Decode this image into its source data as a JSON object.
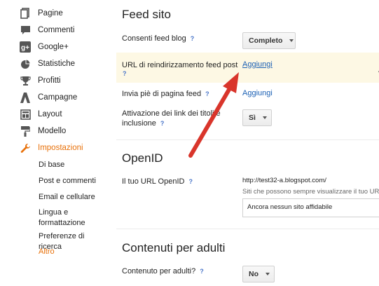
{
  "sidebar": {
    "items": [
      {
        "label": "Pagine",
        "icon": "pages-icon"
      },
      {
        "label": "Commenti",
        "icon": "comment-icon"
      },
      {
        "label": "Google+",
        "icon": "google-plus-icon"
      },
      {
        "label": "Statistiche",
        "icon": "pie-chart-icon"
      },
      {
        "label": "Profitti",
        "icon": "trophy-icon"
      },
      {
        "label": "Campagne",
        "icon": "campaign-icon"
      },
      {
        "label": "Layout",
        "icon": "layout-icon"
      },
      {
        "label": "Modello",
        "icon": "paint-roller-icon"
      },
      {
        "label": "Impostazioni",
        "icon": "wrench-icon"
      }
    ],
    "subitems": [
      "Di base",
      "Post e commenti",
      "Email e cellulare",
      "Lingua e formattazione",
      "Preferenze di ricerca",
      "Altro"
    ]
  },
  "feed": {
    "title": "Feed sito",
    "allow_label": "Consenti feed blog",
    "allow_value": "Completo",
    "redirect_label": "URL di reindirizzamento feed post",
    "redirect_action": "Aggiungi",
    "footer_label": "Invia piè di pagina feed",
    "footer_action": "Aggiungi",
    "title_links_label": "Attivazione dei link dei titoli e inclusione",
    "title_links_value": "Sì",
    "help_mark": "?"
  },
  "openid": {
    "title": "OpenID",
    "url_label": "Il tuo URL OpenID",
    "url_value": "http://test32-a.blogspot.com/",
    "trusted_hint": "Siti che possono sempre visualizzare il tuo URL",
    "trusted_box": "Ancora nessun sito affidabile"
  },
  "adult": {
    "title": "Contenuti per adulti",
    "label": "Contenuto per adulti?",
    "value": "No"
  },
  "colors": {
    "accent": "#e8710a",
    "link": "#1a5fb4",
    "arrow": "#d9352b",
    "highlight": "#fdf8e4"
  }
}
